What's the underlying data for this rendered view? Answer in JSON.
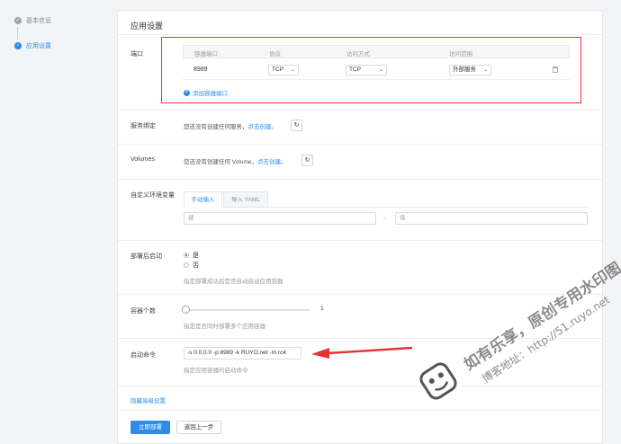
{
  "steps": [
    {
      "label": "基本信息",
      "state": "done",
      "icon": "check-icon"
    },
    {
      "label": "应用设置",
      "state": "active",
      "icon": "arrow-right-icon"
    }
  ],
  "panel_title": "应用设置",
  "ports": {
    "label": "端口",
    "headers": [
      "容器端口",
      "协议",
      "访问方式",
      "访问范围"
    ],
    "row": {
      "container_port": "8989",
      "protocol": "TCP",
      "access_method": "TCP",
      "access_scope": "外部服务"
    },
    "add_label": "添加容器端口"
  },
  "service_binding": {
    "label": "服务绑定",
    "hint": "您还没有创建任何服务，",
    "link": "点击创建。"
  },
  "volumes": {
    "label": "Volumes",
    "hint": "您还没有创建任何 Volume，",
    "link": "点击创建。"
  },
  "env": {
    "label": "自定义环境变量",
    "tabs": [
      "手动输入",
      "导入 YAML"
    ],
    "key_placeholder": "键",
    "dash": "-",
    "value_placeholder": "值"
  },
  "autostart": {
    "label": "部署后启动",
    "options": [
      "是",
      "否"
    ],
    "selected": "是",
    "help": "指定部署成功后是否自动启动应用容器"
  },
  "replicas": {
    "label": "容器个数",
    "value": "1",
    "min": 1,
    "max": 10,
    "help": "指定是否同时部署多个应用容器"
  },
  "command": {
    "label": "启动命令",
    "value": "-s 0.0.0.0 -p 8989 -k RUYO.net -m rc4",
    "help": "指定应用容器的启动命令"
  },
  "advanced_link": "隐藏高级设置",
  "buttons": {
    "deploy": "立即部署",
    "back": "返回上一步"
  },
  "watermark": {
    "line1": "如有乐享，原创专用水印图",
    "line2": "博客地址：http://51.ruyo.net"
  },
  "colors": {
    "accent": "#2d8ce6",
    "highlight_box": "#e33333",
    "arrow": "#e33333"
  }
}
